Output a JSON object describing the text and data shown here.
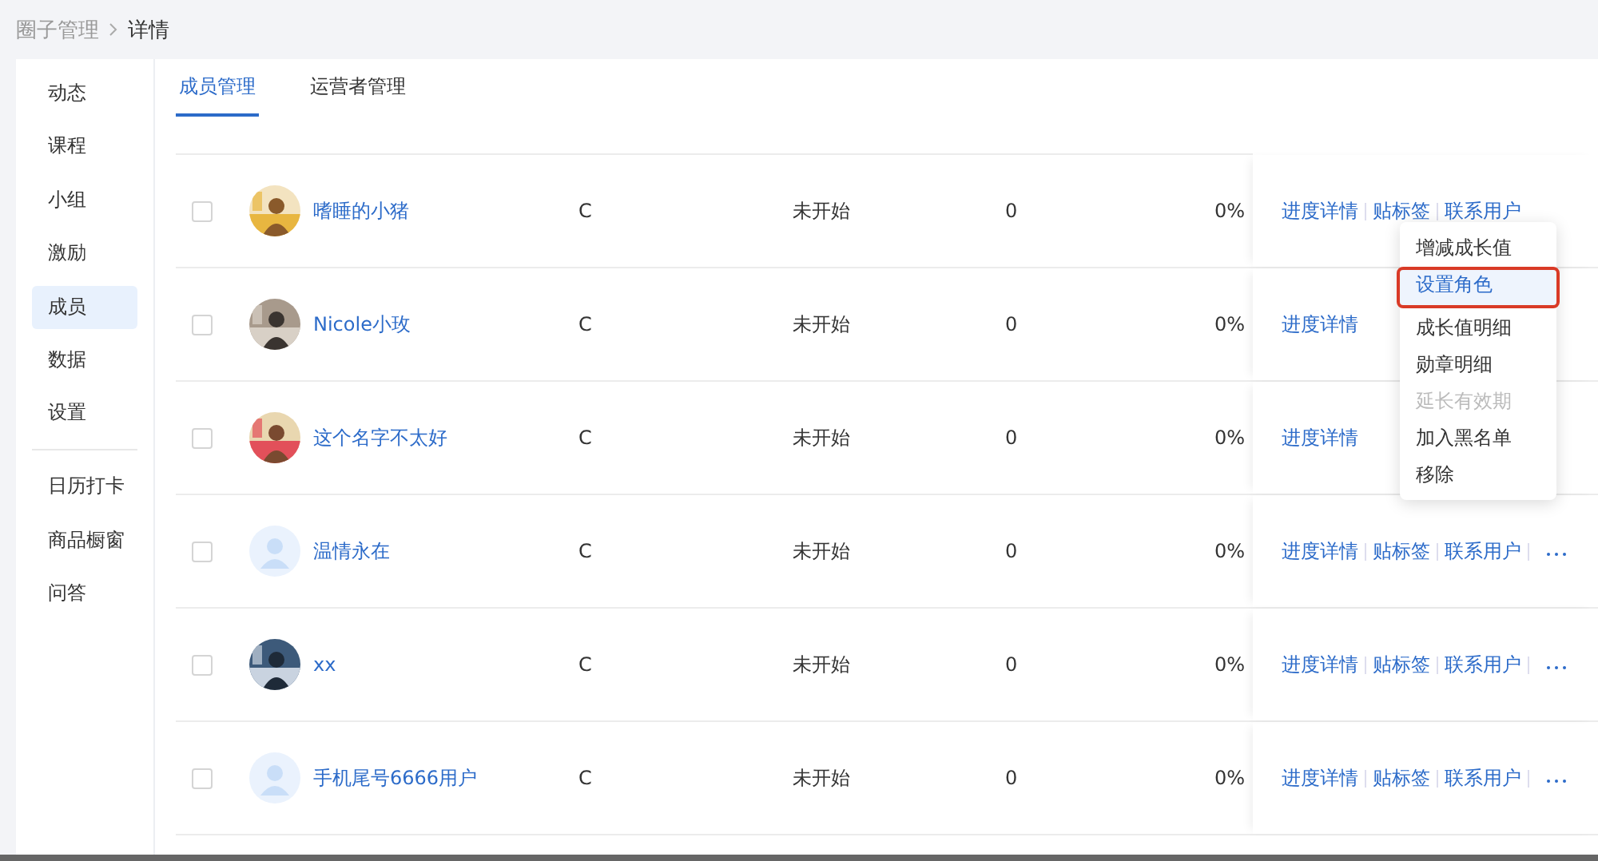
{
  "breadcrumb": [
    {
      "label": "圈子管理"
    },
    {
      "label": "详情"
    }
  ],
  "sidebar": {
    "groups": [
      [
        {
          "label": "动态",
          "selected": false
        },
        {
          "label": "课程",
          "selected": false
        },
        {
          "label": "小组",
          "selected": false
        },
        {
          "label": "激励",
          "selected": false
        },
        {
          "label": "成员",
          "selected": true
        },
        {
          "label": "数据",
          "selected": false
        },
        {
          "label": "设置",
          "selected": false
        }
      ],
      [
        {
          "label": "日历打卡",
          "selected": false
        },
        {
          "label": "商品橱窗",
          "selected": false
        },
        {
          "label": "问答",
          "selected": false
        }
      ]
    ]
  },
  "tabs": [
    {
      "label": "成员管理",
      "selected": true
    },
    {
      "label": "运营者管理",
      "selected": false
    }
  ],
  "table": {
    "rows": [
      {
        "checked": false,
        "avatar": {
          "kind": "picture"
        },
        "name": "嗜睡的小猪",
        "column_3": "C",
        "status": "未开始",
        "column_5": "0",
        "column_6": "0%",
        "actions": [
          "进度详情",
          "贴标签",
          "联系用户"
        ],
        "more": false
      },
      {
        "checked": false,
        "avatar": {
          "kind": "picture"
        },
        "name": "Nicole小玫",
        "column_3": "C",
        "status": "未开始",
        "column_5": "0",
        "column_6": "0%",
        "actions": [
          "进度详情"
        ],
        "more": false
      },
      {
        "checked": false,
        "avatar": {
          "kind": "picture"
        },
        "name": "这个名字不太好",
        "column_3": "C",
        "status": "未开始",
        "column_5": "0",
        "column_6": "0%",
        "actions": [
          "进度详情"
        ],
        "more": false
      },
      {
        "checked": false,
        "avatar": {
          "kind": "default"
        },
        "name": "温情永在",
        "column_3": "C",
        "status": "未开始",
        "column_5": "0",
        "column_6": "0%",
        "actions": [
          "进度详情",
          "贴标签",
          "联系用户"
        ],
        "more": true
      },
      {
        "checked": false,
        "avatar": {
          "kind": "picture"
        },
        "name": "xx",
        "column_3": "C",
        "status": "未开始",
        "column_5": "0",
        "column_6": "0%",
        "actions": [
          "进度详情",
          "贴标签",
          "联系用户"
        ],
        "more": true
      },
      {
        "checked": false,
        "avatar": {
          "kind": "default"
        },
        "name": "手机尾号6666用户",
        "column_3": "C",
        "status": "未开始",
        "column_5": "0",
        "column_6": "0%",
        "actions": [
          "进度详情",
          "贴标签",
          "联系用户"
        ],
        "more": true
      }
    ]
  },
  "more_menu": {
    "items": [
      {
        "label": "增减成长值",
        "selected": false,
        "disabled": false
      },
      {
        "label": "设置角色",
        "selected": true,
        "disabled": false
      },
      {
        "label": "成长值明细",
        "selected": false,
        "disabled": false
      },
      {
        "label": "勋章明细",
        "selected": false,
        "disabled": false
      },
      {
        "label": "延长有效期",
        "selected": false,
        "disabled": true
      },
      {
        "label": "加入黑名单",
        "selected": false,
        "disabled": false
      },
      {
        "label": "移除",
        "selected": false,
        "disabled": false
      }
    ]
  }
}
